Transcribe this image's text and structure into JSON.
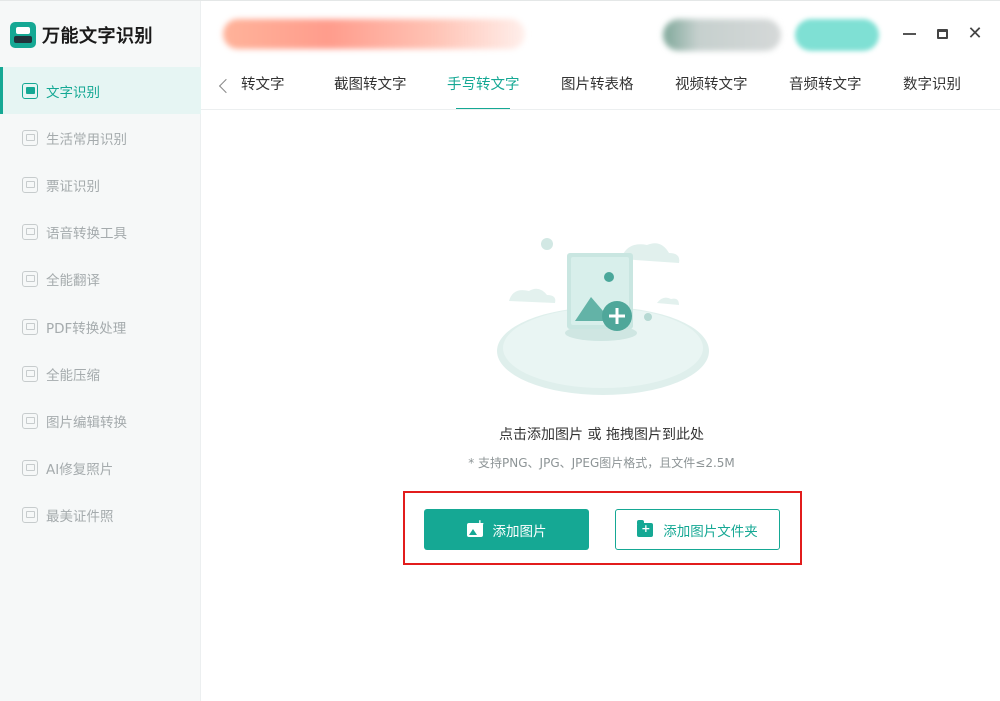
{
  "app": {
    "title": "万能文字识别"
  },
  "sidebar": {
    "items": [
      {
        "label": "文字识别",
        "icon": "ocr-icon",
        "active": true
      },
      {
        "label": "生活常用识别",
        "icon": "life-scan-icon",
        "active": false
      },
      {
        "label": "票证识别",
        "icon": "ticket-scan-icon",
        "active": false
      },
      {
        "label": "语音转换工具",
        "icon": "voice-convert-icon",
        "active": false
      },
      {
        "label": "全能翻译",
        "icon": "translate-icon",
        "active": false
      },
      {
        "label": "PDF转换处理",
        "icon": "pdf-icon",
        "active": false
      },
      {
        "label": "全能压缩",
        "icon": "compress-icon",
        "active": false
      },
      {
        "label": "图片编辑转换",
        "icon": "image-edit-icon",
        "active": false
      },
      {
        "label": "AI修复照片",
        "icon": "ai-repair-icon",
        "active": false
      },
      {
        "label": "最美证件照",
        "icon": "id-photo-icon",
        "active": false
      }
    ]
  },
  "tabs": {
    "items": [
      {
        "label": "转文字",
        "active": false
      },
      {
        "label": "截图转文字",
        "active": false
      },
      {
        "label": "手写转文字",
        "active": true
      },
      {
        "label": "图片转表格",
        "active": false
      },
      {
        "label": "视频转文字",
        "active": false
      },
      {
        "label": "音频转文字",
        "active": false
      },
      {
        "label": "数字识别",
        "active": false
      }
    ]
  },
  "upload": {
    "hint": "点击添加图片 或 拖拽图片到此处",
    "sub_hint": "* 支持PNG、JPG、JPEG图片格式，且文件≤2.5M",
    "add_image_label": "添加图片",
    "add_folder_label": "添加图片文件夹"
  },
  "colors": {
    "accent": "#15a894",
    "highlight": "#e21c1c",
    "sidebar_bg": "#f6f8f8",
    "muted_text": "#a5abad"
  }
}
